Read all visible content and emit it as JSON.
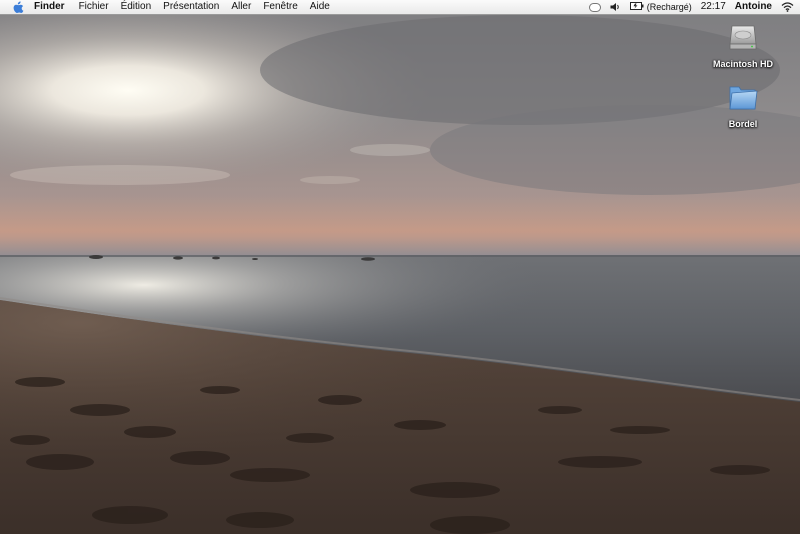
{
  "menubar": {
    "app_name": "Finder",
    "items": [
      {
        "label": "Fichier"
      },
      {
        "label": "Édition"
      },
      {
        "label": "Présentation"
      },
      {
        "label": "Aller"
      },
      {
        "label": "Fenêtre"
      },
      {
        "label": "Aide"
      }
    ],
    "status": {
      "battery_text": "(Rechargé)",
      "clock": "22:17",
      "user": "Antoine"
    }
  },
  "desktop": {
    "icons": [
      {
        "label": "Macintosh HD",
        "icon": "hard-drive-icon"
      },
      {
        "label": "Bordel",
        "icon": "folder-icon"
      }
    ]
  },
  "colors": {
    "menubar_bg": "#f2f2f2",
    "menubar_text": "#111111",
    "apple_blue": "#3b7dd8",
    "folder_blue": "#7fb2e6",
    "icon_label": "#ffffff"
  }
}
